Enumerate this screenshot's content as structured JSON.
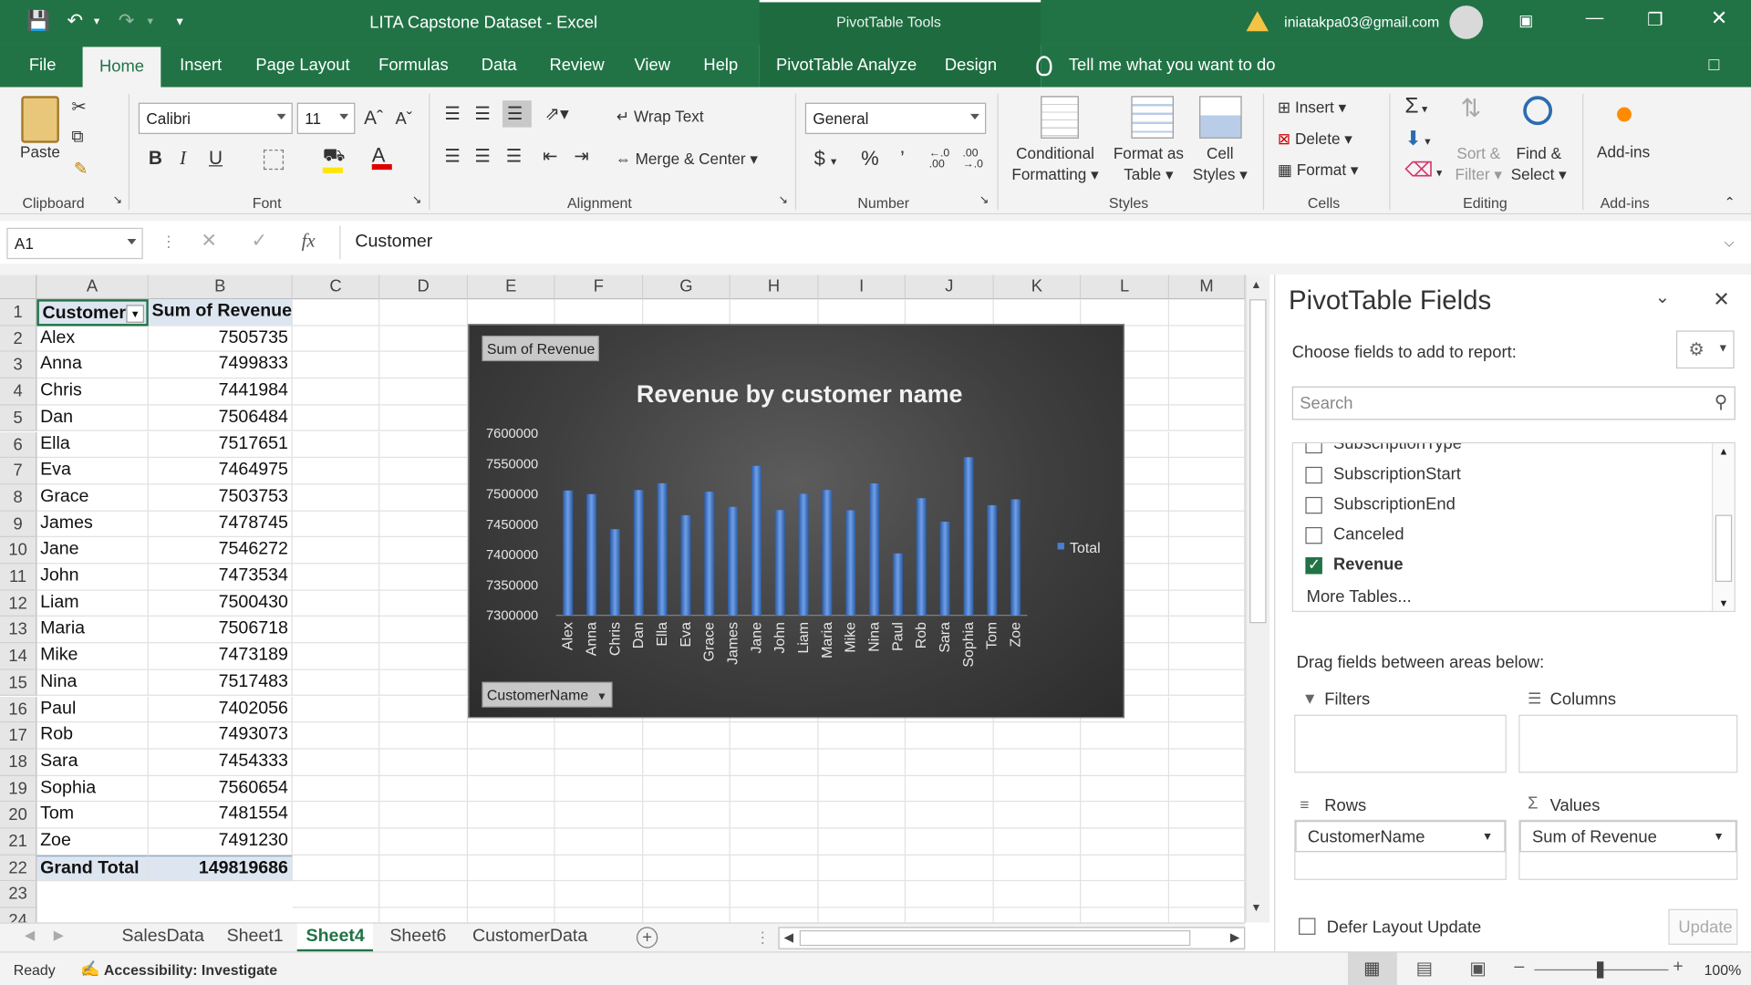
{
  "title_bar": {
    "title": "LITA Capstone Dataset  -  Excel",
    "context_tools": "PivotTable Tools",
    "account": "iniatakpa03@gmail.com"
  },
  "tabs": [
    "File",
    "Home",
    "Insert",
    "Page Layout",
    "Formulas",
    "Data",
    "Review",
    "View",
    "Help",
    "PivotTable Analyze",
    "Design"
  ],
  "active_tab": "Home",
  "tell_me": "Tell me what you want to do",
  "ribbon": {
    "clipboard": {
      "paste": "Paste",
      "label": "Clipboard"
    },
    "font": {
      "name": "Calibri",
      "size": "11",
      "label": "Font",
      "bold": "B",
      "italic": "I",
      "underline": "U"
    },
    "alignment": {
      "wrap": "Wrap Text",
      "merge": "Merge & Center",
      "label": "Alignment"
    },
    "number": {
      "format": "General",
      "currency": "$",
      "percent": "%",
      "comma": "’",
      "inc": "←.0 .00",
      "dec": ".00 →.0",
      "label": "Number"
    },
    "styles": {
      "conditional": "Conditional",
      "conditional2": "Formatting",
      "format_as": "Format as",
      "format_as2": "Table",
      "cell": "Cell",
      "cell2": "Styles",
      "label": "Styles"
    },
    "cells": {
      "insert": "Insert",
      "delete": "Delete",
      "format": "Format",
      "label": "Cells"
    },
    "editing": {
      "sort": "Sort &",
      "sort2": "Filter",
      "find": "Find &",
      "find2": "Select",
      "label": "Editing"
    },
    "addins": {
      "btn": "Add-ins",
      "label": "Add-ins"
    }
  },
  "formula_bar": {
    "name_box": "A1",
    "fx": "fx",
    "content": "Customer"
  },
  "columns": [
    "A",
    "B",
    "C",
    "D",
    "E",
    "F",
    "G",
    "H",
    "I",
    "J",
    "K",
    "L",
    "M"
  ],
  "pivot_table": {
    "header": [
      "Customer",
      "Sum of Revenue"
    ],
    "rows": [
      [
        "Alex",
        "7505735"
      ],
      [
        "Anna",
        "7499833"
      ],
      [
        "Chris",
        "7441984"
      ],
      [
        "Dan",
        "7506484"
      ],
      [
        "Ella",
        "7517651"
      ],
      [
        "Eva",
        "7464975"
      ],
      [
        "Grace",
        "7503753"
      ],
      [
        "James",
        "7478745"
      ],
      [
        "Jane",
        "7546272"
      ],
      [
        "John",
        "7473534"
      ],
      [
        "Liam",
        "7500430"
      ],
      [
        "Maria",
        "7506718"
      ],
      [
        "Mike",
        "7473189"
      ],
      [
        "Nina",
        "7517483"
      ],
      [
        "Paul",
        "7402056"
      ],
      [
        "Rob",
        "7493073"
      ],
      [
        "Sara",
        "7454333"
      ],
      [
        "Sophia",
        "7560654"
      ],
      [
        "Tom",
        "7481554"
      ],
      [
        "Zoe",
        "7491230"
      ]
    ],
    "total": [
      "Grand Total",
      "149819686"
    ]
  },
  "row_numbers": [
    "1",
    "2",
    "3",
    "4",
    "5",
    "6",
    "7",
    "8",
    "9",
    "10",
    "11",
    "12",
    "13",
    "14",
    "15",
    "16",
    "17",
    "18",
    "19",
    "20",
    "21",
    "22",
    "23",
    "24"
  ],
  "chart_data": {
    "type": "bar",
    "title": "Revenue by customer name",
    "value_button": "Sum of Revenue",
    "axis_button": "CustomerName",
    "categories": [
      "Alex",
      "Anna",
      "Chris",
      "Dan",
      "Ella",
      "Eva",
      "Grace",
      "James",
      "Jane",
      "John",
      "Liam",
      "Maria",
      "Mike",
      "Nina",
      "Paul",
      "Rob",
      "Sara",
      "Sophia",
      "Tom",
      "Zoe"
    ],
    "series": [
      {
        "name": "Total",
        "values": [
          7505735,
          7499833,
          7441984,
          7506484,
          7517651,
          7464975,
          7503753,
          7478745,
          7546272,
          7473534,
          7500430,
          7506718,
          7473189,
          7517483,
          7402056,
          7493073,
          7454333,
          7560654,
          7481554,
          7491230
        ]
      }
    ],
    "ylim": [
      7300000,
      7600000
    ],
    "yticks": [
      "7600000",
      "7550000",
      "7500000",
      "7450000",
      "7400000",
      "7350000",
      "7300000"
    ],
    "legend": "right",
    "bar_color": "#4a7fd0"
  },
  "pane": {
    "title": "PivotTable Fields",
    "subtitle": "Choose fields to add to report:",
    "search_placeholder": "Search",
    "fields": [
      {
        "name": "SubscriptionType",
        "checked": false
      },
      {
        "name": "SubscriptionStart",
        "checked": false
      },
      {
        "name": "SubscriptionEnd",
        "checked": false
      },
      {
        "name": "Canceled",
        "checked": false
      },
      {
        "name": "Revenue",
        "checked": true
      }
    ],
    "more_tables": "More Tables...",
    "drag_label": "Drag fields between areas below:",
    "filters": "Filters",
    "columns": "Columns",
    "rows": "Rows",
    "values": "Values",
    "rows_field": "CustomerName",
    "values_field": "Sum of Revenue",
    "defer": "Defer Layout Update",
    "update": "Update"
  },
  "sheets": [
    "SalesData",
    "Sheet1",
    "Sheet4",
    "Sheet6",
    "CustomerData"
  ],
  "active_sheet": "Sheet4",
  "status": {
    "ready": "Ready",
    "accessibility": "Accessibility: Investigate",
    "zoom": "100%"
  }
}
